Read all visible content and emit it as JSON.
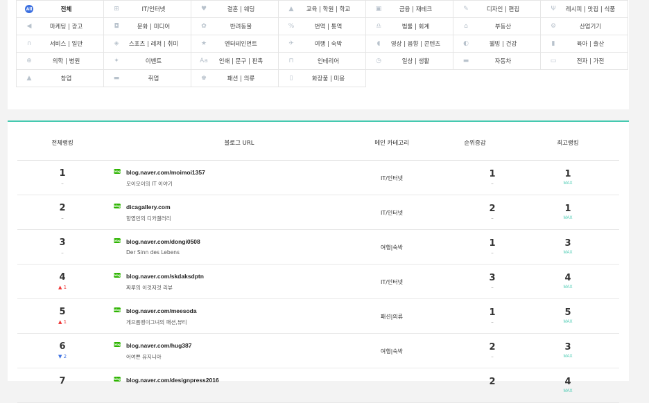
{
  "categories": [
    {
      "label": "전체",
      "icon": "all-icon",
      "glyph": "All",
      "active": true
    },
    {
      "label": "IT/인터넷",
      "icon": "it-icon",
      "glyph": "⊞"
    },
    {
      "label": "결혼 | 웨딩",
      "icon": "heart-icon",
      "glyph": "♥"
    },
    {
      "label": "교육 | 학원 | 학교",
      "icon": "graduation-cap-icon",
      "glyph": "▲"
    },
    {
      "label": "금융 | 재테크",
      "icon": "money-icon",
      "glyph": "▣"
    },
    {
      "label": "디자인 | 편집",
      "icon": "pencil-icon",
      "glyph": "✎"
    },
    {
      "label": "레시피 | 맛집 | 식품",
      "icon": "fork-knife-icon",
      "glyph": "Ψ"
    },
    {
      "label": "마케팅 | 광고",
      "icon": "megaphone-icon",
      "glyph": "◀"
    },
    {
      "label": "문화 | 미디어",
      "icon": "camera-icon",
      "glyph": "◘"
    },
    {
      "label": "반려동물",
      "icon": "paw-icon",
      "glyph": "✿"
    },
    {
      "label": "번역 | 통역",
      "icon": "translate-icon",
      "glyph": "%"
    },
    {
      "label": "법률 | 회계",
      "icon": "scale-icon",
      "glyph": "♎"
    },
    {
      "label": "부동산",
      "icon": "house-icon",
      "glyph": "⌂"
    },
    {
      "label": "산업기기",
      "icon": "gear-icon",
      "glyph": "⚙"
    },
    {
      "label": "서비스 | 일반",
      "icon": "headset-icon",
      "glyph": "∩"
    },
    {
      "label": "스포츠 | 레저 | 취미",
      "icon": "sports-icon",
      "glyph": "◈"
    },
    {
      "label": "엔터테인먼트",
      "icon": "star-icon",
      "glyph": "★"
    },
    {
      "label": "여행 | 숙박",
      "icon": "airplane-icon",
      "glyph": "✈"
    },
    {
      "label": "영상 | 음향 | 콘텐츠",
      "icon": "speaker-icon",
      "glyph": "◖"
    },
    {
      "label": "웰빙 | 건강",
      "icon": "pill-icon",
      "glyph": "◐"
    },
    {
      "label": "육아 | 출산",
      "icon": "baby-bottle-icon",
      "glyph": "▮"
    },
    {
      "label": "의학 | 병원",
      "icon": "medical-cross-icon",
      "glyph": "⊕"
    },
    {
      "label": "이벤트",
      "icon": "party-icon",
      "glyph": "✦"
    },
    {
      "label": "인쇄 | 문구 | 판촉",
      "icon": "font-icon",
      "glyph": "Aa"
    },
    {
      "label": "인테리어",
      "icon": "window-icon",
      "glyph": "⊓"
    },
    {
      "label": "일상 | 생활",
      "icon": "clock-icon",
      "glyph": "◷"
    },
    {
      "label": "자동차",
      "icon": "car-icon",
      "glyph": "▬"
    },
    {
      "label": "전자 | 가전",
      "icon": "monitor-icon",
      "glyph": "▭"
    },
    {
      "label": "창업",
      "icon": "store-icon",
      "glyph": "▲"
    },
    {
      "label": "취업",
      "icon": "briefcase-icon",
      "glyph": "▬"
    },
    {
      "label": "패션 | 의류",
      "icon": "shirt-icon",
      "glyph": "♚"
    },
    {
      "label": "화장품 | 미용",
      "icon": "cosmetics-icon",
      "glyph": "▯"
    }
  ],
  "table": {
    "headers": {
      "rank": "전체랭킹",
      "url": "블로그 URL",
      "category": "메인 카테고리",
      "change": "순위증감",
      "best": "최고랭킹"
    },
    "badge_text": "blog",
    "max_label": "MAX",
    "rows": [
      {
        "rank": "1",
        "rank_change": "–",
        "rank_dir": "none",
        "url": "blog.naver.com/moimoi1357",
        "name": "모이모이의 IT 이야기",
        "category": "IT/인터넷",
        "change": "1",
        "change_sub": "–",
        "best": "1"
      },
      {
        "rank": "2",
        "rank_change": "–",
        "rank_dir": "none",
        "url": "dicagallery.com",
        "name": "항영민의 디카갤러리",
        "category": "IT/인터넷",
        "change": "2",
        "change_sub": "–",
        "best": "1"
      },
      {
        "rank": "3",
        "rank_change": "–",
        "rank_dir": "none",
        "url": "blog.naver.com/dongi0508",
        "name": "Der Sinn des Lebens",
        "category": "여행|숙박",
        "change": "1",
        "change_sub": "–",
        "best": "3"
      },
      {
        "rank": "4",
        "rank_change": "▲ 1",
        "rank_dir": "up",
        "url": "blog.naver.com/skdaksdptn",
        "name": "짜루의 이것저것 리뷰",
        "category": "IT/인터넷",
        "change": "3",
        "change_sub": "–",
        "best": "4"
      },
      {
        "rank": "5",
        "rank_change": "▲ 1",
        "rank_dir": "up",
        "url": "blog.naver.com/meesoda",
        "name": "게으름뱅이그녀의 패션,뷰티",
        "category": "패션|의류",
        "change": "1",
        "change_sub": "–",
        "best": "5"
      },
      {
        "rank": "6",
        "rank_change": "▼ 2",
        "rank_dir": "down",
        "url": "blog.naver.com/hug387",
        "name": "어여쁜 유지니아",
        "category": "여행|숙박",
        "change": "2",
        "change_sub": "–",
        "best": "3"
      },
      {
        "rank": "7",
        "rank_change": "",
        "rank_dir": "none",
        "url": "blog.naver.com/designpress2016",
        "name": "",
        "category": "",
        "change": "2",
        "change_sub": "",
        "best": "4"
      }
    ]
  }
}
